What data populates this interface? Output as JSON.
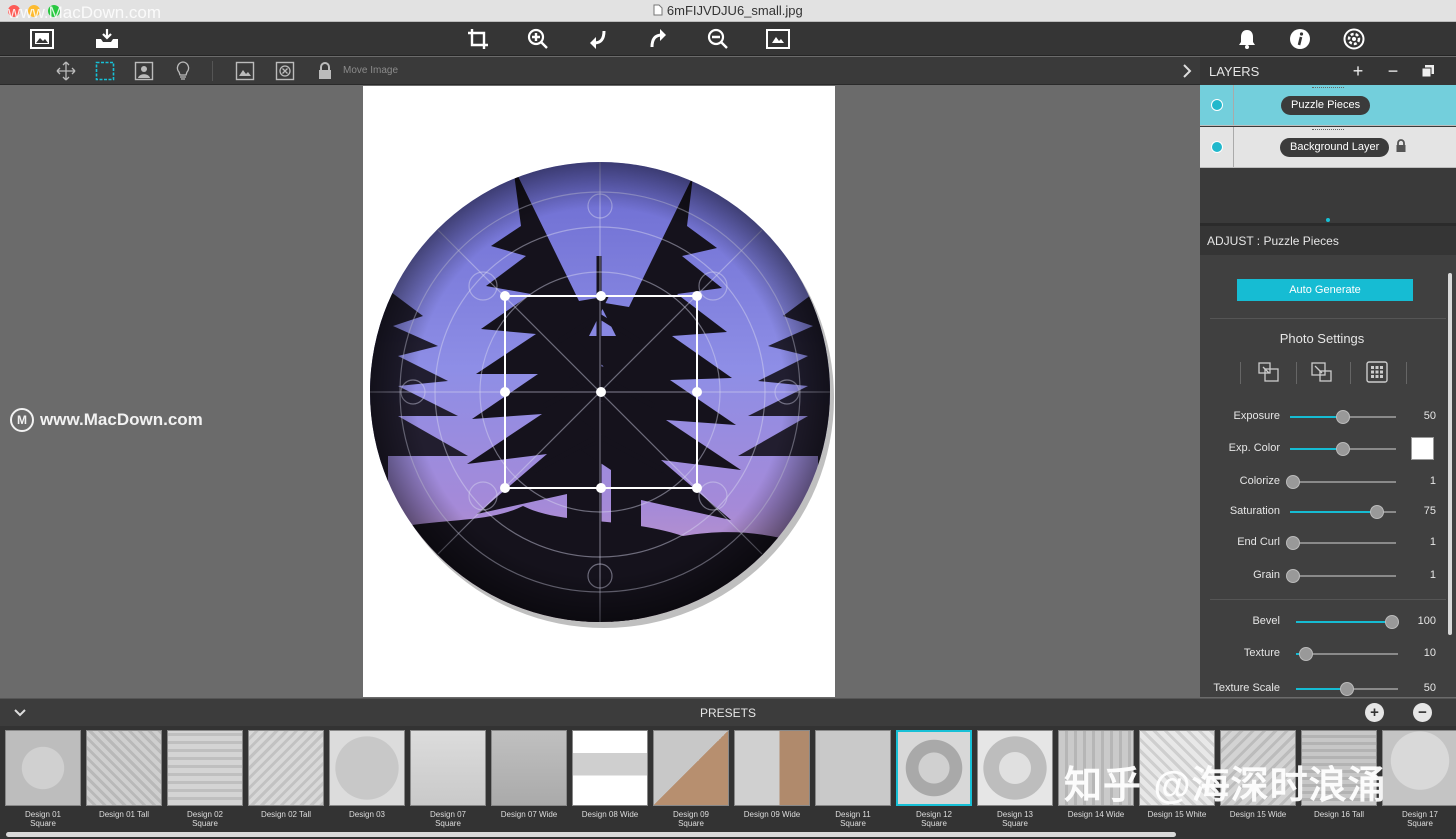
{
  "window": {
    "title": "6mFIJVDJU6_small.jpg"
  },
  "watermarks": {
    "top": "www.MacDown.com",
    "middle": "www.MacDown.com",
    "middle_logo": "M",
    "bottom": "知乎 @海深时浪涌"
  },
  "toolbar": {
    "left_icons": [
      "open-image-icon",
      "export-icon"
    ],
    "center_icons": [
      "crop-icon",
      "zoom-in-icon",
      "undo-icon",
      "redo-icon",
      "zoom-out-icon",
      "fit-icon"
    ],
    "right_icons": [
      "bell-icon",
      "info-icon",
      "settings-icon"
    ]
  },
  "subtoolbar": {
    "move_image_label": "Move Image"
  },
  "layers": {
    "title": "LAYERS",
    "items": [
      {
        "label": "Puzzle Pieces",
        "selected": true
      },
      {
        "label": "Background Layer",
        "locked": true
      }
    ]
  },
  "adjust": {
    "title": "ADJUST : Puzzle Pieces",
    "auto_generate": "Auto Generate",
    "photo_settings": "Photo Settings",
    "sliders": [
      {
        "label": "Exposure",
        "value": "50",
        "fraction": 0.5
      },
      {
        "label": "Exp. Color",
        "value": "",
        "fraction": 0.5
      },
      {
        "label": "Colorize",
        "value": "1",
        "fraction": 0.0
      },
      {
        "label": "Saturation",
        "value": "75",
        "fraction": 0.82
      },
      {
        "label": "End Curl",
        "value": "1",
        "fraction": 0.0
      },
      {
        "label": "Grain",
        "value": "1",
        "fraction": 0.0
      },
      {
        "label": "Bevel",
        "value": "100",
        "fraction": 1.0
      },
      {
        "label": "Texture",
        "value": "10",
        "fraction": 0.1
      },
      {
        "label": "Texture Scale",
        "value": "50",
        "fraction": 0.5
      }
    ]
  },
  "presets": {
    "title": "PRESETS",
    "items": [
      {
        "label": "Design 01\nSquare"
      },
      {
        "label": "Design 01 Tall"
      },
      {
        "label": "Design 02\nSquare"
      },
      {
        "label": "Design 02 Tall"
      },
      {
        "label": "Design 03"
      },
      {
        "label": "Design 07\nSquare"
      },
      {
        "label": "Design 07 Wide"
      },
      {
        "label": "Design 08 Wide"
      },
      {
        "label": "Design 09\nSquare"
      },
      {
        "label": "Design 09 Wide"
      },
      {
        "label": "Design 11\nSquare"
      },
      {
        "label": "Design 12\nSquare",
        "selected": true
      },
      {
        "label": "Design 13\nSquare"
      },
      {
        "label": "Design 14 Wide"
      },
      {
        "label": "Design 15 White"
      },
      {
        "label": "Design 15 Wide"
      },
      {
        "label": "Design 16 Tall"
      },
      {
        "label": "Design 17\nSquare"
      }
    ]
  },
  "colors": {
    "accent": "#16bcd3",
    "selected_layer": "#73cfdc"
  }
}
